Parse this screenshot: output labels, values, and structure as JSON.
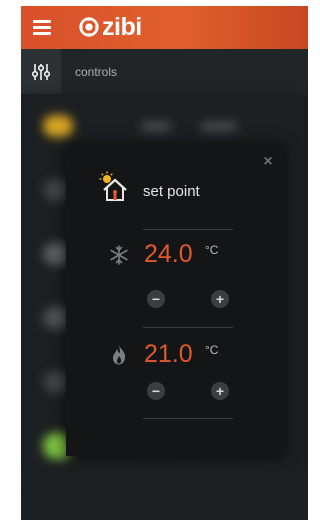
{
  "header": {
    "menu_icon": "hamburger-menu-icon",
    "brand": "zibi",
    "brand_color": "#e0582c"
  },
  "subbar": {
    "icon": "sliders-icon",
    "title": "controls"
  },
  "dialog": {
    "icon": "house-sun-icon",
    "title": "set point",
    "close_icon": "close-icon",
    "close_label": "×",
    "cooling": {
      "icon": "snowflake-icon",
      "value": "24.0",
      "unit": "°C",
      "decrease": "−",
      "increase": "+"
    },
    "heating": {
      "icon": "flame-icon",
      "value": "21.0",
      "unit": "°C",
      "decrease": "−",
      "increase": "+"
    }
  }
}
